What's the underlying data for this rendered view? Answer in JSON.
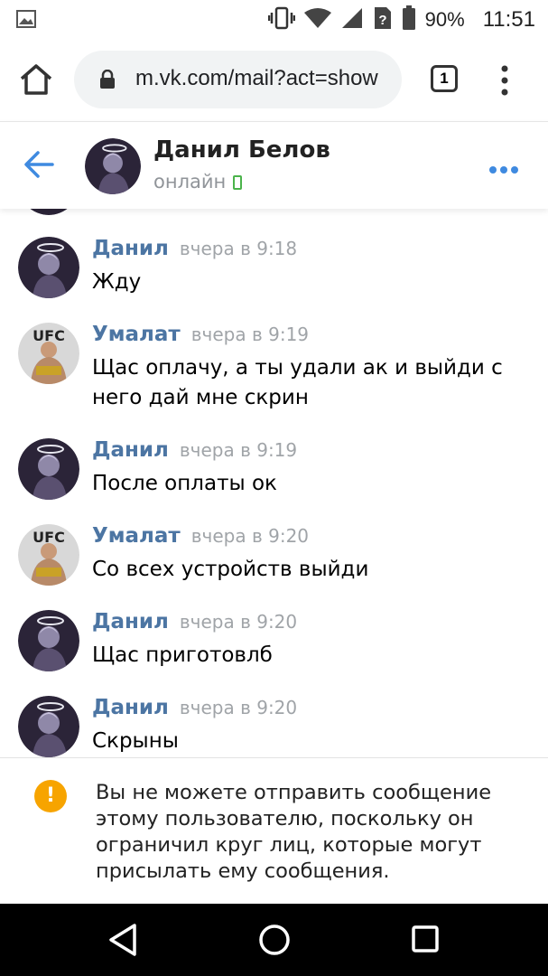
{
  "status_bar": {
    "battery": "90%",
    "time": "11:51"
  },
  "browser": {
    "url": "m.vk.com/mail?act=show",
    "tab_count": "1"
  },
  "chat_header": {
    "name": "Данил Белов",
    "status": "онлайн"
  },
  "messages": [
    {
      "author": "Данил",
      "time": "вчера в 9:18",
      "text": "Жду",
      "avatar": "halo-avatar"
    },
    {
      "author": "Умалат",
      "time": "вчера в 9:19",
      "text": "Щас оплачу, а ты удали ак и выйди с него дай мне скрин",
      "avatar": "ufc-avatar"
    },
    {
      "author": "Данил",
      "time": "вчера в 9:19",
      "text": "После оплаты ок",
      "avatar": "halo-avatar"
    },
    {
      "author": "Умалат",
      "time": "вчера в 9:20",
      "text": "Со всех устройств выйди",
      "avatar": "ufc-avatar"
    },
    {
      "author": "Данил",
      "time": "вчера в 9:20",
      "text": "Щас приготовлб",
      "avatar": "halo-avatar"
    },
    {
      "author": "Данил",
      "time": "вчера в 9:20",
      "text": "Скрыны",
      "avatar": "halo-avatar"
    }
  ],
  "notice": {
    "icon": "!",
    "text": "Вы не можете отправить сообщение этому пользователю, поскольку он ограничил круг лиц, которые могут присылать ему сообщения."
  },
  "colors": {
    "accent": "#4c75a3",
    "back_arrow": "#3f8ae0",
    "online": "#4bb34b",
    "warning": "#f7a400"
  }
}
